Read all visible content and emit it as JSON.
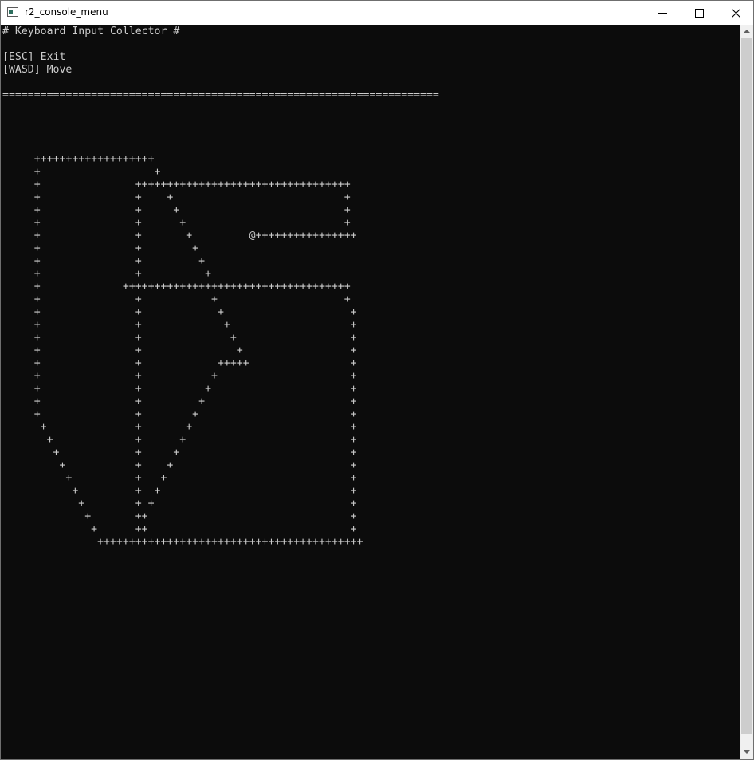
{
  "window": {
    "title": "r2_console_menu",
    "icon": "console-app-icon",
    "buttons": [
      "minimize-icon",
      "maximize-icon",
      "close-icon"
    ]
  },
  "console": {
    "lines": [
      "# Keyboard Input Collector #",
      "",
      "[ESC] Exit",
      "[WASD] Move",
      "",
      "=====================================================================",
      "",
      "",
      "",
      "",
      "     +++++++++++++++++++",
      "     +                  +",
      "     +               ++++++++++++++++++++++++++++++++++",
      "     +               +    +                           +",
      "     +               +     +                          +",
      "     +               +      +                         +",
      "     +               +       +         @++++++++++++++++",
      "     +               +        +",
      "     +               +         +",
      "     +               +          +",
      "     +             ++++++++++++++++++++++++++++++++++++",
      "     +               +           +                    +",
      "     +               +            +                    +",
      "     +               +             +                   +",
      "     +               +              +                  +",
      "     +               +               +                 +",
      "     +               +            +++++                +",
      "     +               +           +                     +",
      "     +               +          +                      +",
      "     +               +         +                       +",
      "     +               +        +                        +",
      "      +              +       +                         +",
      "       +             +      +                          +",
      "        +            +     +                           +",
      "         +           +    +                            +",
      "          +          +   +                             +",
      "           +         +  +                              +",
      "            +        + +                               +",
      "             +       ++                                +",
      "              +      ++                                +",
      "               ++++++++++++++++++++++++++++++++++++++++++"
    ]
  }
}
